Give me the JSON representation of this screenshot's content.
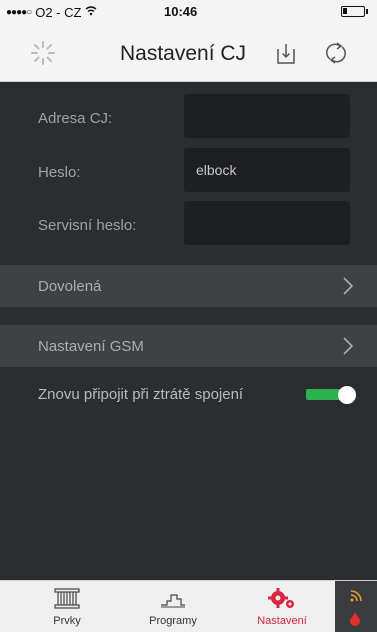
{
  "status_bar": {
    "carrier": "O2 - CZ",
    "time": "10:46"
  },
  "nav": {
    "title": "Nastavení CJ"
  },
  "form": {
    "address_label": "Adresa CJ:",
    "address_value": "",
    "password_label": "Heslo:",
    "password_value": "elbock",
    "service_password_label": "Servisní heslo:",
    "service_password_value": ""
  },
  "menu": {
    "vacation_label": "Dovolená",
    "gsm_label": "Nastavení GSM"
  },
  "reconnect": {
    "label": "Znovu připojit při ztrátě spojení",
    "enabled": true
  },
  "tabs": [
    {
      "label": "Prvky",
      "icon": "radiator-icon",
      "active": false
    },
    {
      "label": "Programy",
      "icon": "program-icon",
      "active": false
    },
    {
      "label": "Nastavení",
      "icon": "gears-icon",
      "active": true
    }
  ],
  "colors": {
    "accent": "#d7263d",
    "toggle_on": "#2bb24c",
    "content_bg": "#2b2d2f"
  }
}
